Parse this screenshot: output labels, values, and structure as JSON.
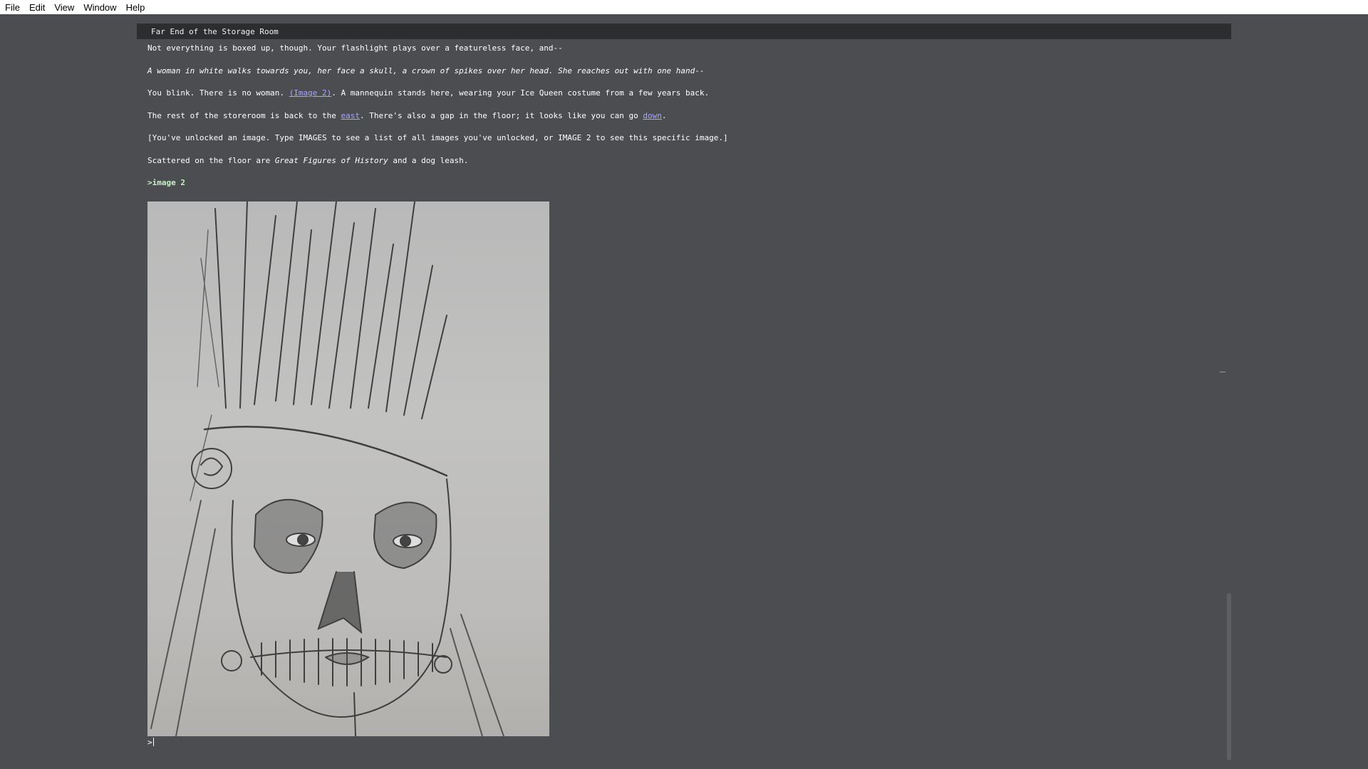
{
  "menu": {
    "items": [
      "File",
      "Edit",
      "View",
      "Window",
      "Help"
    ]
  },
  "status": {
    "location": "Far End of the Storage Room"
  },
  "story": {
    "p1": "Not everything is boxed up, though. Your flashlight plays over a featureless face, and--",
    "p2": "A woman in white walks towards you, her face a skull, a crown of spikes over her head. She reaches out with one hand--",
    "p3_a": "You blink. There is no woman. ",
    "p3_link": "(Image 2)",
    "p3_b": ". A mannequin stands here, wearing your Ice Queen costume from a few years back.",
    "p4_a": "The rest of the storeroom is back to the ",
    "p4_link_east": "east",
    "p4_b": ". There's also a gap in the floor; it looks like you can go ",
    "p4_link_down": "down",
    "p4_c": ".",
    "p5": "[You've unlocked an image. Type IMAGES to see a list of all images you've unlocked, or IMAGE 2 to see this specific image.]",
    "p6_a": "Scattered on the floor are ",
    "p6_em": "Great Figures of History",
    "p6_b": " and a dog leash.",
    "command": ">image 2"
  },
  "prompt": {
    "symbol": ">",
    "value": ""
  },
  "colors": {
    "background": "#4c4d50",
    "status_bar": "#2c2d2f",
    "link": "#a6a6ff",
    "command": "#c8f0c8"
  }
}
